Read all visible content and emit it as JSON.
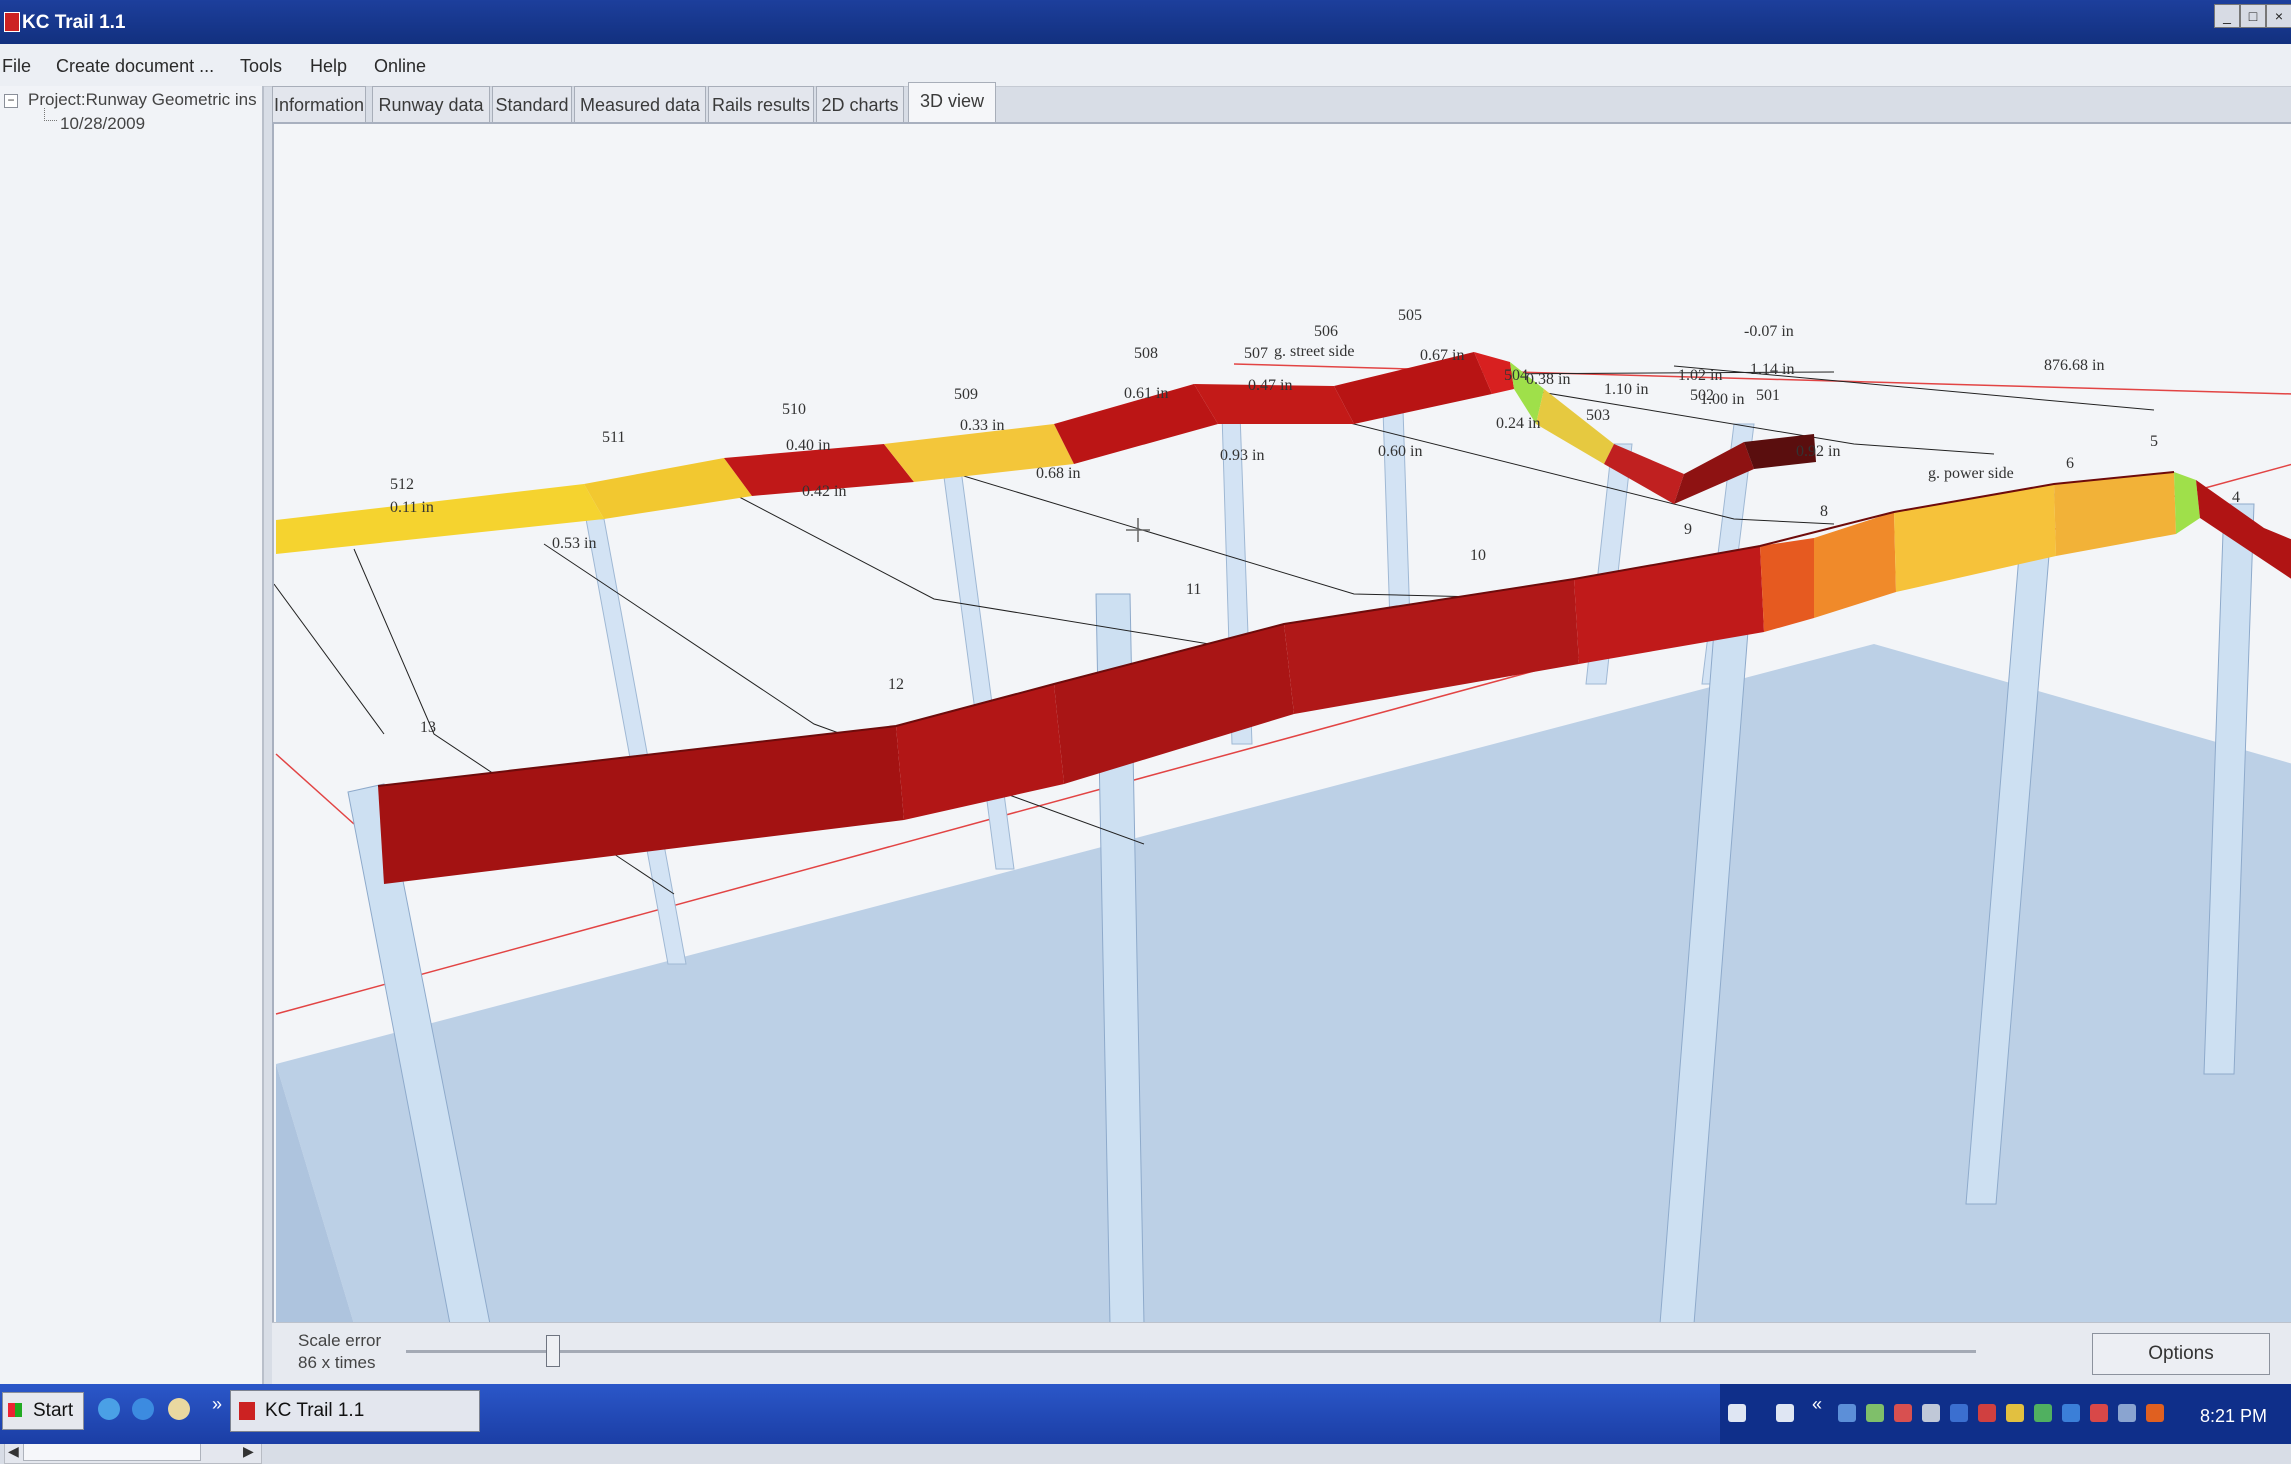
{
  "window": {
    "title": "KC Trail 1.1",
    "controls": [
      "_",
      "□",
      "×"
    ]
  },
  "menu": [
    "File",
    "Create document ...",
    "Tools",
    "Help",
    "Online"
  ],
  "tree": {
    "toggle": "−",
    "root": "Project:Runway Geometric ins",
    "child": "10/28/2009"
  },
  "tabs": [
    "Information",
    "Runway data",
    "Standard",
    "Measured data",
    "Rails results",
    "2D charts",
    "3D view"
  ],
  "active_tab": "3D view",
  "scene": {
    "frame_numbers": [
      "512",
      "511",
      "510",
      "509",
      "508",
      "507",
      "506",
      "505",
      "504",
      "503",
      "502",
      "501",
      "13",
      "12",
      "11",
      "10",
      "9",
      "8",
      "6",
      "5",
      "4"
    ],
    "measurements": [
      "0.11 in",
      "0.53 in",
      "0.40 in",
      "0.42 in",
      "0.33 in",
      "0.68 in",
      "0.61 in",
      "0.93 in",
      "0.47 in",
      "0.60 in",
      "0.67 in",
      "0.38 in",
      "0.24 in",
      "1.10 in",
      "1.02 in",
      "1.14 in",
      "-0.07 in",
      "1.00 in",
      "0.92 in",
      "876.68 in"
    ],
    "side_labels": [
      "g. street side",
      "g. power side"
    ],
    "colors": {
      "red": "#b71414",
      "yellow": "#f7d33a",
      "orange": "#f0a02c",
      "green": "#9fe04a",
      "column": "#cfe0f2",
      "floor": "#b8cde4"
    }
  },
  "bottom": {
    "scale_label": "Scale error",
    "scale_value": "86 x times",
    "options": "Options"
  },
  "taskbar": {
    "start": "Start",
    "chevron": "»",
    "task": "KC Trail 1.1",
    "tray_chevron": "«",
    "clock": "8:21 PM"
  }
}
